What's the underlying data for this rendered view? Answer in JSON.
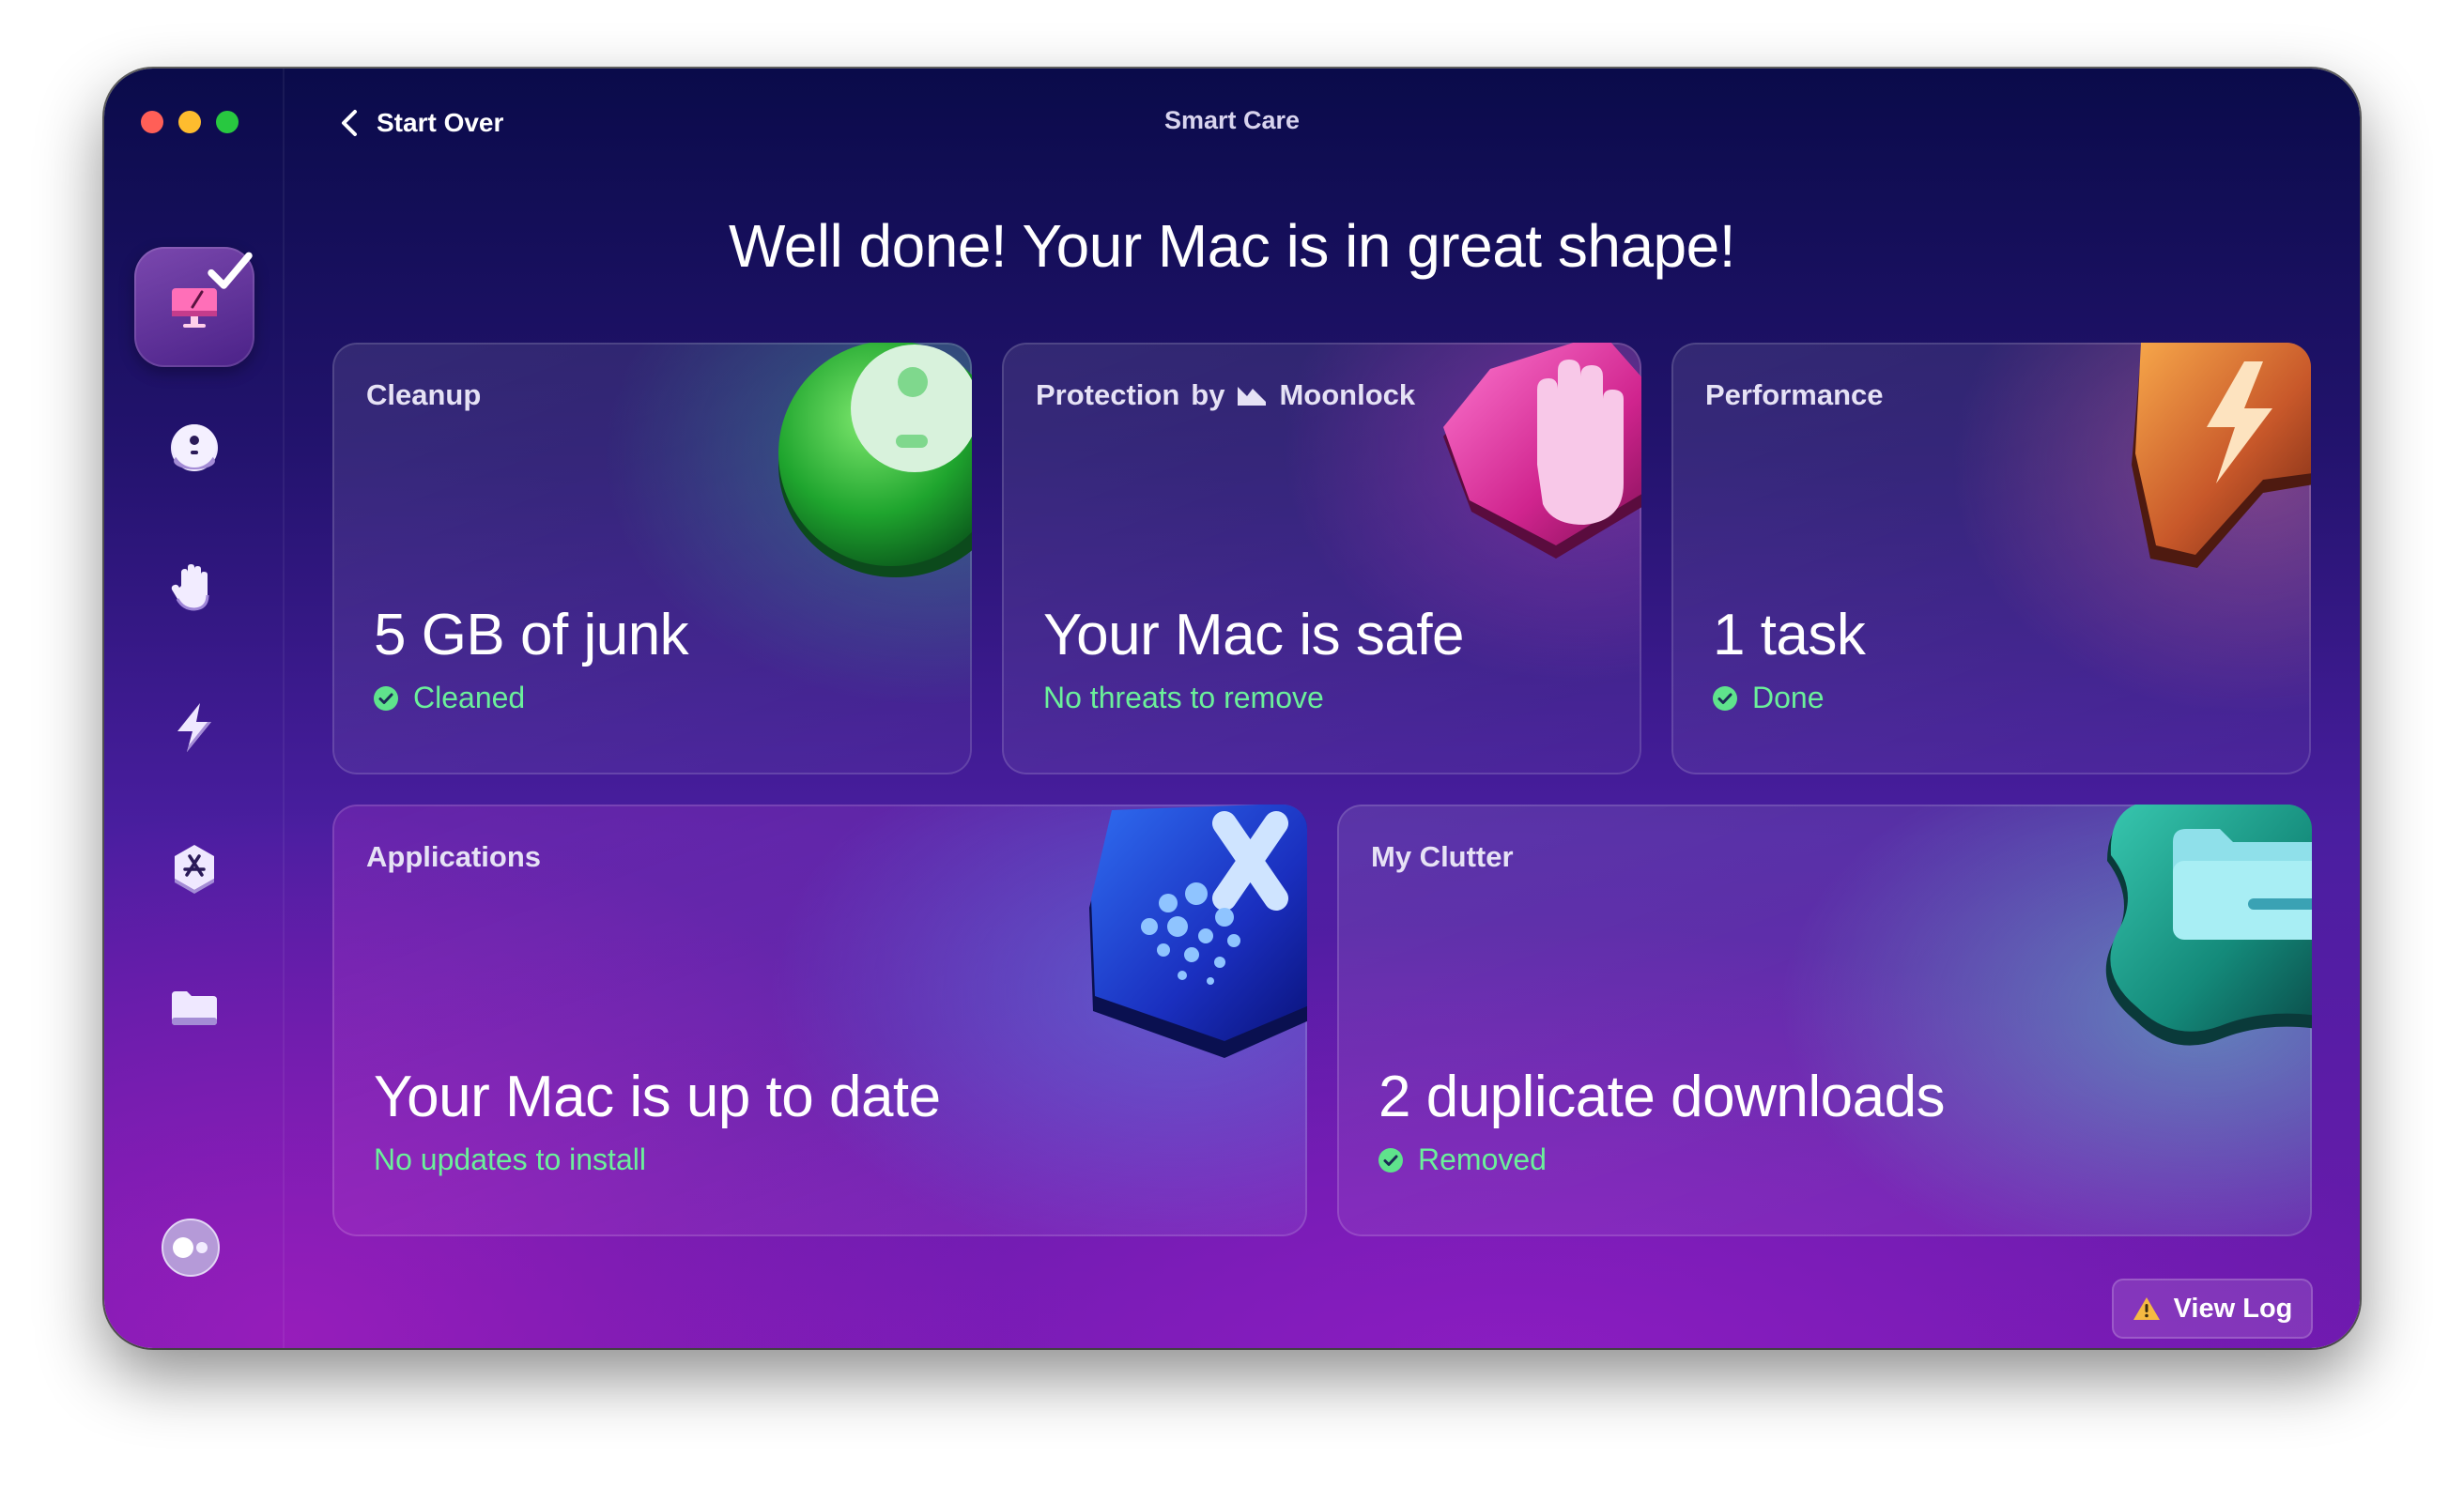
{
  "window": {
    "title": "Smart Care",
    "back_label": "Start Over"
  },
  "headline": "Well done! Your Mac is in great shape!",
  "sidebar": {
    "items": [
      {
        "name": "smart-care",
        "icon": "monitor-broom-icon",
        "active": true,
        "completed": true
      },
      {
        "name": "cleanup",
        "icon": "disc-icon"
      },
      {
        "name": "protection",
        "icon": "hand-icon"
      },
      {
        "name": "performance",
        "icon": "lightning-icon"
      },
      {
        "name": "applications",
        "icon": "app-store-icon"
      },
      {
        "name": "my-clutter",
        "icon": "folder-icon"
      }
    ],
    "assistant_icon": "assistant-toggle-icon"
  },
  "cards": {
    "cleanup": {
      "label": "Cleanup",
      "value": "5 GB of junk",
      "status": "Cleaned"
    },
    "protection": {
      "label_prefix": "Protection",
      "label_by": "by",
      "brand": "Moonlock",
      "value": "Your Mac is safe",
      "status": "No threats to remove"
    },
    "performance": {
      "label": "Performance",
      "value": "1 task",
      "status": "Done"
    },
    "applications": {
      "label": "Applications",
      "value": "Your Mac is up to date",
      "status": "No updates to install"
    },
    "clutter": {
      "label": "My Clutter",
      "value": "2 duplicate downloads",
      "status": "Removed"
    }
  },
  "footer": {
    "view_log_label": "View Log",
    "warning_icon": "warning-triangle-icon"
  },
  "colors": {
    "status_green": "#6bf09a",
    "accent_purple": "#7a1db0",
    "background_navy": "#0a0b4a"
  }
}
